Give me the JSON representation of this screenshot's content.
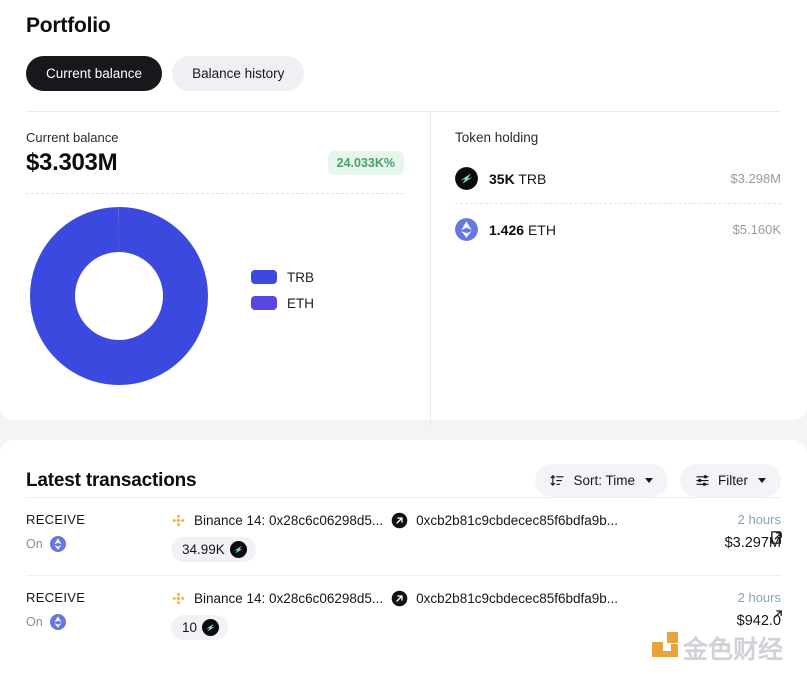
{
  "header": {
    "title": "Portfolio",
    "tabs": [
      {
        "label": "Current balance",
        "active": true
      },
      {
        "label": "Balance history",
        "active": false
      }
    ]
  },
  "balance": {
    "label": "Current balance",
    "amount": "$3.303M",
    "change_badge": "24.033K%",
    "badge_bg": "#e7f6ec",
    "badge_color": "#4aa06d"
  },
  "chart_data": {
    "type": "pie",
    "title": "",
    "categories": [
      "TRB",
      "ETH"
    ],
    "values": [
      3.298,
      0.00516
    ],
    "percentages": [
      99.84,
      0.16
    ],
    "colors": [
      "#3b49df",
      "#5a46e0"
    ],
    "legend_position": "right",
    "donut": true,
    "inner_radius_ratio": 0.5
  },
  "token_holding": {
    "title": "Token holding",
    "rows": [
      {
        "icon": "trb-token-icon",
        "amount": "35K",
        "symbol": "TRB",
        "usd": "$3.298M"
      },
      {
        "icon": "eth-token-icon",
        "amount": "1.426",
        "symbol": "ETH",
        "usd": "$5.160K"
      }
    ]
  },
  "transactions": {
    "title": "Latest transactions",
    "sort_label": "Sort: Time",
    "filter_label": "Filter",
    "rows": [
      {
        "type": "RECEIVE",
        "on_label": "On",
        "chain_icon": "eth-chain-icon",
        "from_label": "Binance 14: 0x28c6c06298d5...",
        "to_label": "0xcb2b81c9cbdecec85f6bdfa9b...",
        "amount": "34.99K",
        "amount_icon": "trb-token-icon",
        "time": "2 hours",
        "usd": "$3.297M"
      },
      {
        "type": "RECEIVE",
        "on_label": "On",
        "chain_icon": "eth-chain-icon",
        "from_label": "Binance 14: 0x28c6c06298d5...",
        "to_label": "0xcb2b81c9cbdecec85f6bdfa9b...",
        "amount": "10",
        "amount_icon": "trb-token-icon",
        "time": "2 hours",
        "usd": "$942.0"
      }
    ]
  },
  "watermark": {
    "text": "金色财经"
  }
}
